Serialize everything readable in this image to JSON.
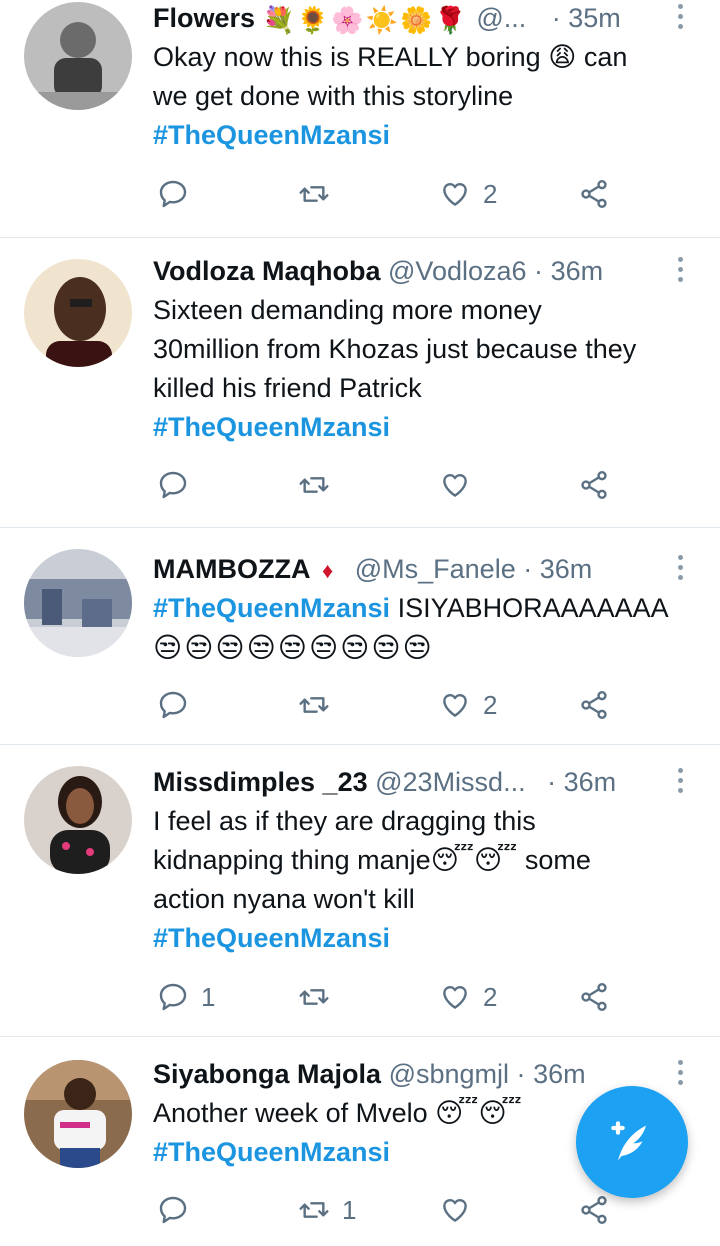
{
  "accent_color": "#1da1f2",
  "hashtag_color": "#1b95e0",
  "tweets": [
    {
      "name": "Flowers",
      "name_decoration": "💐🌻🌸☀️🌼🌹",
      "handle": "@...",
      "separator": "·",
      "time": "35m",
      "lines": [
        "Okay now this is REALLY boring 😩 can",
        "we get done with this storyline"
      ],
      "hashtag": "#TheQueenMzansi",
      "replies": "",
      "retweets": "",
      "likes": "2"
    },
    {
      "name": "Vodloza Maqhoba",
      "handle": "@Vodloza6",
      "separator": "·",
      "time": "36m",
      "lines": [
        "Sixteen demanding more money",
        "30million from Khozas just because they",
        "killed his friend Patrick"
      ],
      "hashtag": "#TheQueenMzansi",
      "replies": "",
      "retweets": "",
      "likes": ""
    },
    {
      "name": "MAMBOZZA",
      "name_badge": "♦",
      "handle": "@Ms_Fanele",
      "separator": "·",
      "time": "36m",
      "hashtag": "#TheQueenMzansi",
      "trailing_text": "ISIYABHORAAAAAAA",
      "emoji_line": "😒😒😒😒😒😒😒😒😒",
      "replies": "",
      "retweets": "",
      "likes": "2"
    },
    {
      "name": "Missdimples _23",
      "handle": "@23Missd...",
      "separator": "·",
      "time": "36m",
      "lines": [
        "I feel as if they are dragging this",
        "kidnapping thing manje😴😴 some",
        "action nyana won't kill"
      ],
      "hashtag": "#TheQueenMzansi",
      "replies": "1",
      "retweets": "",
      "likes": "2"
    },
    {
      "name": "Siyabonga Majola",
      "handle": "@sbngmjl",
      "separator": "·",
      "time": "36m",
      "lines": [
        "Another week of Mvelo 😴😴"
      ],
      "hashtag": "#TheQueenMzansi",
      "replies": "",
      "retweets": "1",
      "likes": ""
    }
  ],
  "icons": {
    "reply": "reply-icon",
    "retweet": "retweet-icon",
    "like": "heart-icon",
    "share": "share-icon",
    "more": "more-icon",
    "compose": "compose-tweet-icon"
  }
}
